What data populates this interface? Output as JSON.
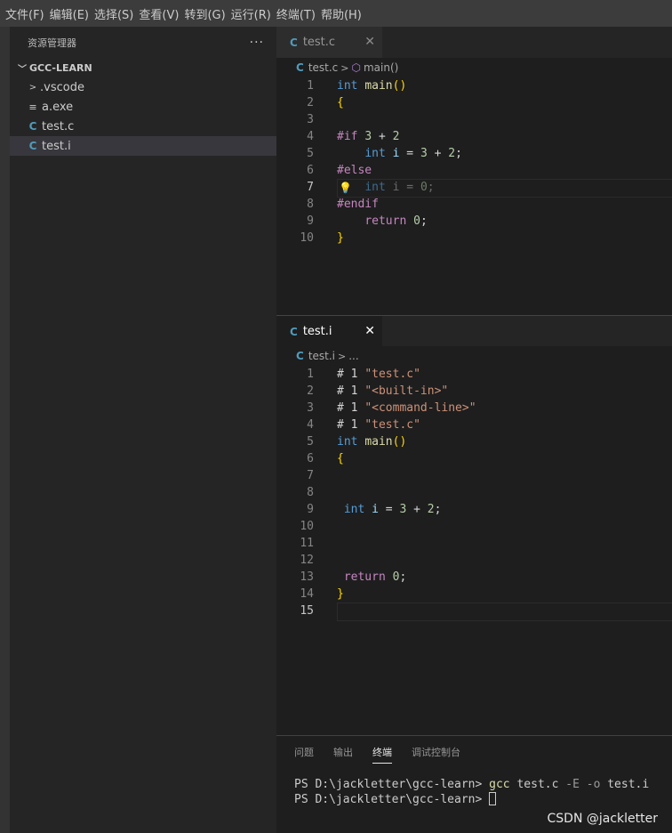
{
  "menubar": {
    "items": [
      "文件(F)",
      "编辑(E)",
      "选择(S)",
      "查看(V)",
      "转到(G)",
      "运行(R)",
      "终端(T)",
      "帮助(H)"
    ]
  },
  "sidebar": {
    "title": "资源管理器",
    "more": "···",
    "folder": "GCC-LEARN",
    "items": [
      ".vscode",
      "a.exe",
      "test.c",
      "test.i"
    ]
  },
  "editor1": {
    "tab": "test.c",
    "file_icon": "C",
    "breadcrumb_file": "test.c",
    "breadcrumb_symbol": "main()",
    "line_numbers": [
      "1",
      "2",
      "3",
      "4",
      "5",
      "6",
      "7",
      "8",
      "9",
      "10"
    ]
  },
  "editor2": {
    "tab": "test.i",
    "file_icon": "C",
    "breadcrumb_file": "test.i",
    "breadcrumb_symbol": "...",
    "line_numbers": [
      "1",
      "2",
      "3",
      "4",
      "5",
      "6",
      "7",
      "8",
      "9",
      "10",
      "11",
      "12",
      "13",
      "14",
      "15"
    ]
  },
  "panel": {
    "tabs": [
      "问题",
      "输出",
      "终端",
      "调试控制台"
    ],
    "active_tab": "终端",
    "terminal_prompt": "PS D:\\jackletter\\gcc-learn>",
    "terminal_cmd": "gcc",
    "terminal_args": "test.c",
    "terminal_flags": "-E -o",
    "terminal_out": "test.i"
  },
  "watermark": "CSDN @jackletter",
  "colors": {
    "accent_c_icon": "#519aba",
    "keyword": "#569cd6",
    "control": "#c586c0",
    "function": "#dcdcaa",
    "string": "#ce9178",
    "number": "#b5cea8"
  },
  "icons": {
    "lightbulb": "lightbulb-icon",
    "close": "close-icon",
    "symbol": "cube-icon",
    "chevron": "chevron-icon"
  }
}
